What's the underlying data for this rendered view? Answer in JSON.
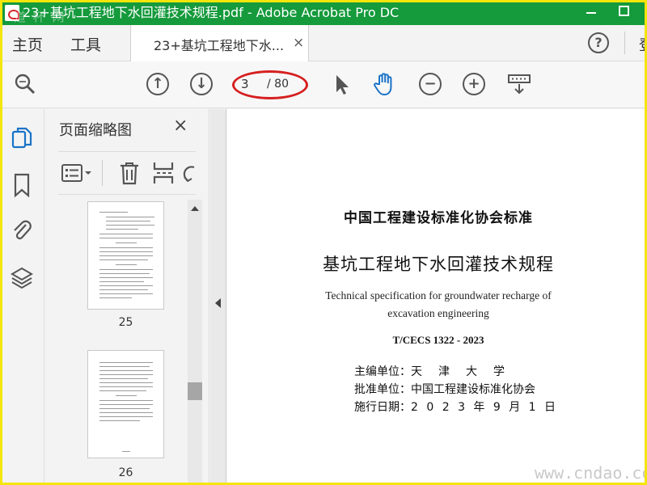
{
  "window": {
    "title": "23+基坑工程地下水回灌技术规程.pdf - Adobe Acrobat Pro DC",
    "watermark": "道 杯 网"
  },
  "tabs": {
    "home": "主页",
    "tools": "工具",
    "doc": "23+基坑工程地下水...",
    "close": "×",
    "help": "?",
    "signin_partial": "登"
  },
  "toolbar": {
    "page_current": "3",
    "page_total": "/ 80"
  },
  "thumbnails": {
    "title": "页面缩略图",
    "close": "×",
    "pages": [
      {
        "label": "25"
      },
      {
        "label": "26"
      }
    ]
  },
  "document": {
    "org": "中国工程建设标准化协会标准",
    "title_cn": "基坑工程地下水回灌技术规程",
    "title_en_1": "Technical specification for groundwater recharge of",
    "title_en_2": "excavation engineering",
    "code": "T/CECS 1322 - 2023",
    "meta": [
      {
        "key": "主编单位：",
        "value": "天　津　大　学"
      },
      {
        "key": "批准单位：",
        "value": "中国工程建设标准化协会"
      },
      {
        "key": "施行日期：",
        "value": "2 0 2 3 年 9 月 1 日"
      }
    ]
  },
  "watermark_bottom": "www.cndao.com",
  "colors": {
    "titlebar": "#159a3c",
    "frame": "#f4e50a",
    "accent_blue": "#1a73c8",
    "annotation_red": "#d61f1f"
  },
  "icons": [
    "zoom-search-icon",
    "page-up-icon",
    "page-down-icon",
    "select-arrow-icon",
    "hand-tool-icon",
    "zoom-out-icon",
    "zoom-in-icon",
    "marquee-zoom-icon",
    "pages-icon",
    "bookmark-icon",
    "attachment-icon",
    "layers-icon",
    "options-list-icon",
    "delete-icon",
    "insert-page-icon",
    "rotate-icon"
  ]
}
